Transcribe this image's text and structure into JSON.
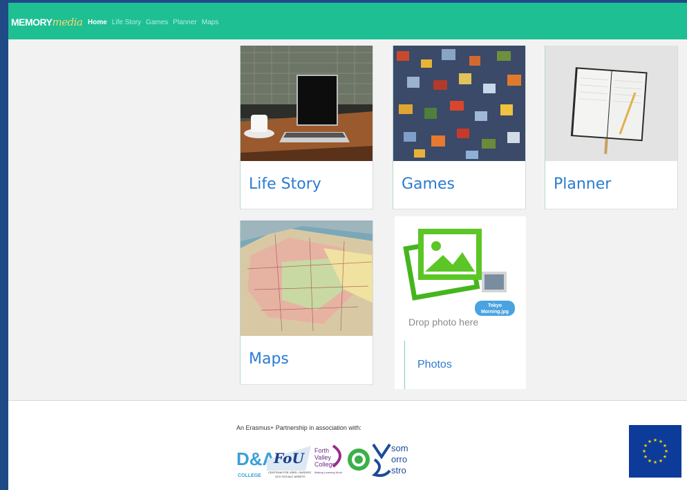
{
  "brand": {
    "memory": "MEMORY",
    "media": "media"
  },
  "nav": {
    "home": "Home",
    "life_story": "Life Story",
    "games": "Games",
    "planner": "Planner",
    "maps": "Maps"
  },
  "cards": {
    "life_story": "Life Story",
    "games": "Games",
    "planner": "Planner",
    "maps": "Maps",
    "photos": "Photos"
  },
  "photos_image": {
    "drop_text": "Drop photo here",
    "file_label_line1": "Tokyo",
    "file_label_line2": "Morning.jpg"
  },
  "footer": {
    "partnership": "An Erasmus+ Partnership in association with:",
    "logo_da": "D&A",
    "logo_da_sub": "COLLEGE",
    "logo_fou": "FoU",
    "logo_fou_sub1": "CENTRUM FÖR VÅRD, OMSORG",
    "logo_fou_sub2": "OCH SOCIALT ARBETE",
    "logo_forth1": "Forth",
    "logo_forth2": "Valley",
    "logo_forth3": "College",
    "logo_forth_tag": "Making Learning Work",
    "logo_som1": "som",
    "logo_som2": "orro",
    "logo_som3": "stro"
  }
}
